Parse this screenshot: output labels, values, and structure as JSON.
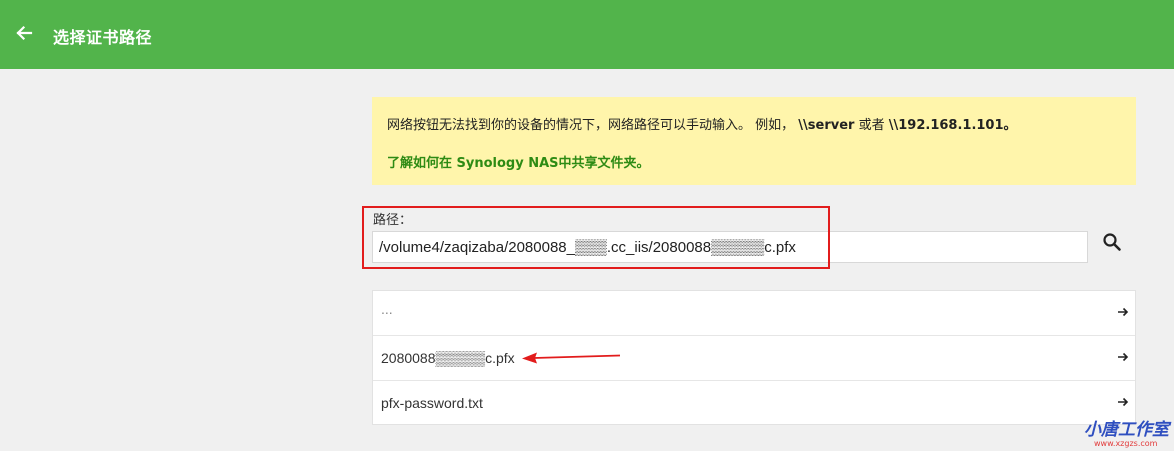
{
  "appbar": {
    "title": "选择证书路径",
    "back_icon": "arrow-left-icon",
    "color": "#52b44b"
  },
  "notice": {
    "text_prefix": "网络按钮无法找到你的设备的情况下，网络路径可以手动输入。 例如，",
    "example1": "\\\\server",
    "connector": "或者",
    "example2": "\\\\192.168.1.101。",
    "link_text": "了解如何在 Synology NAS中共享文件夹。",
    "bg_color": "#fff5ab",
    "link_color": "#2e8b14"
  },
  "path": {
    "label": "路径：",
    "value": "/volume4/zaqizaba/2080088_▒▒▒.cc_iis/2080088▒▒▒▒▒c.pfx",
    "search_icon": "search-icon"
  },
  "files": [
    {
      "name": "...",
      "is_parent": true,
      "icon": "arrow-right-icon"
    },
    {
      "name": "2080088▒▒▒▒▒c.pfx",
      "is_parent": false,
      "icon": "arrow-right-icon"
    },
    {
      "name": "pfx-password.txt",
      "is_parent": false,
      "icon": "arrow-right-icon"
    }
  ],
  "annotations": {
    "highlight_color": "#e21c1c"
  },
  "watermark": {
    "text": "小唐工作室",
    "url": "www.xzgzs.com"
  }
}
